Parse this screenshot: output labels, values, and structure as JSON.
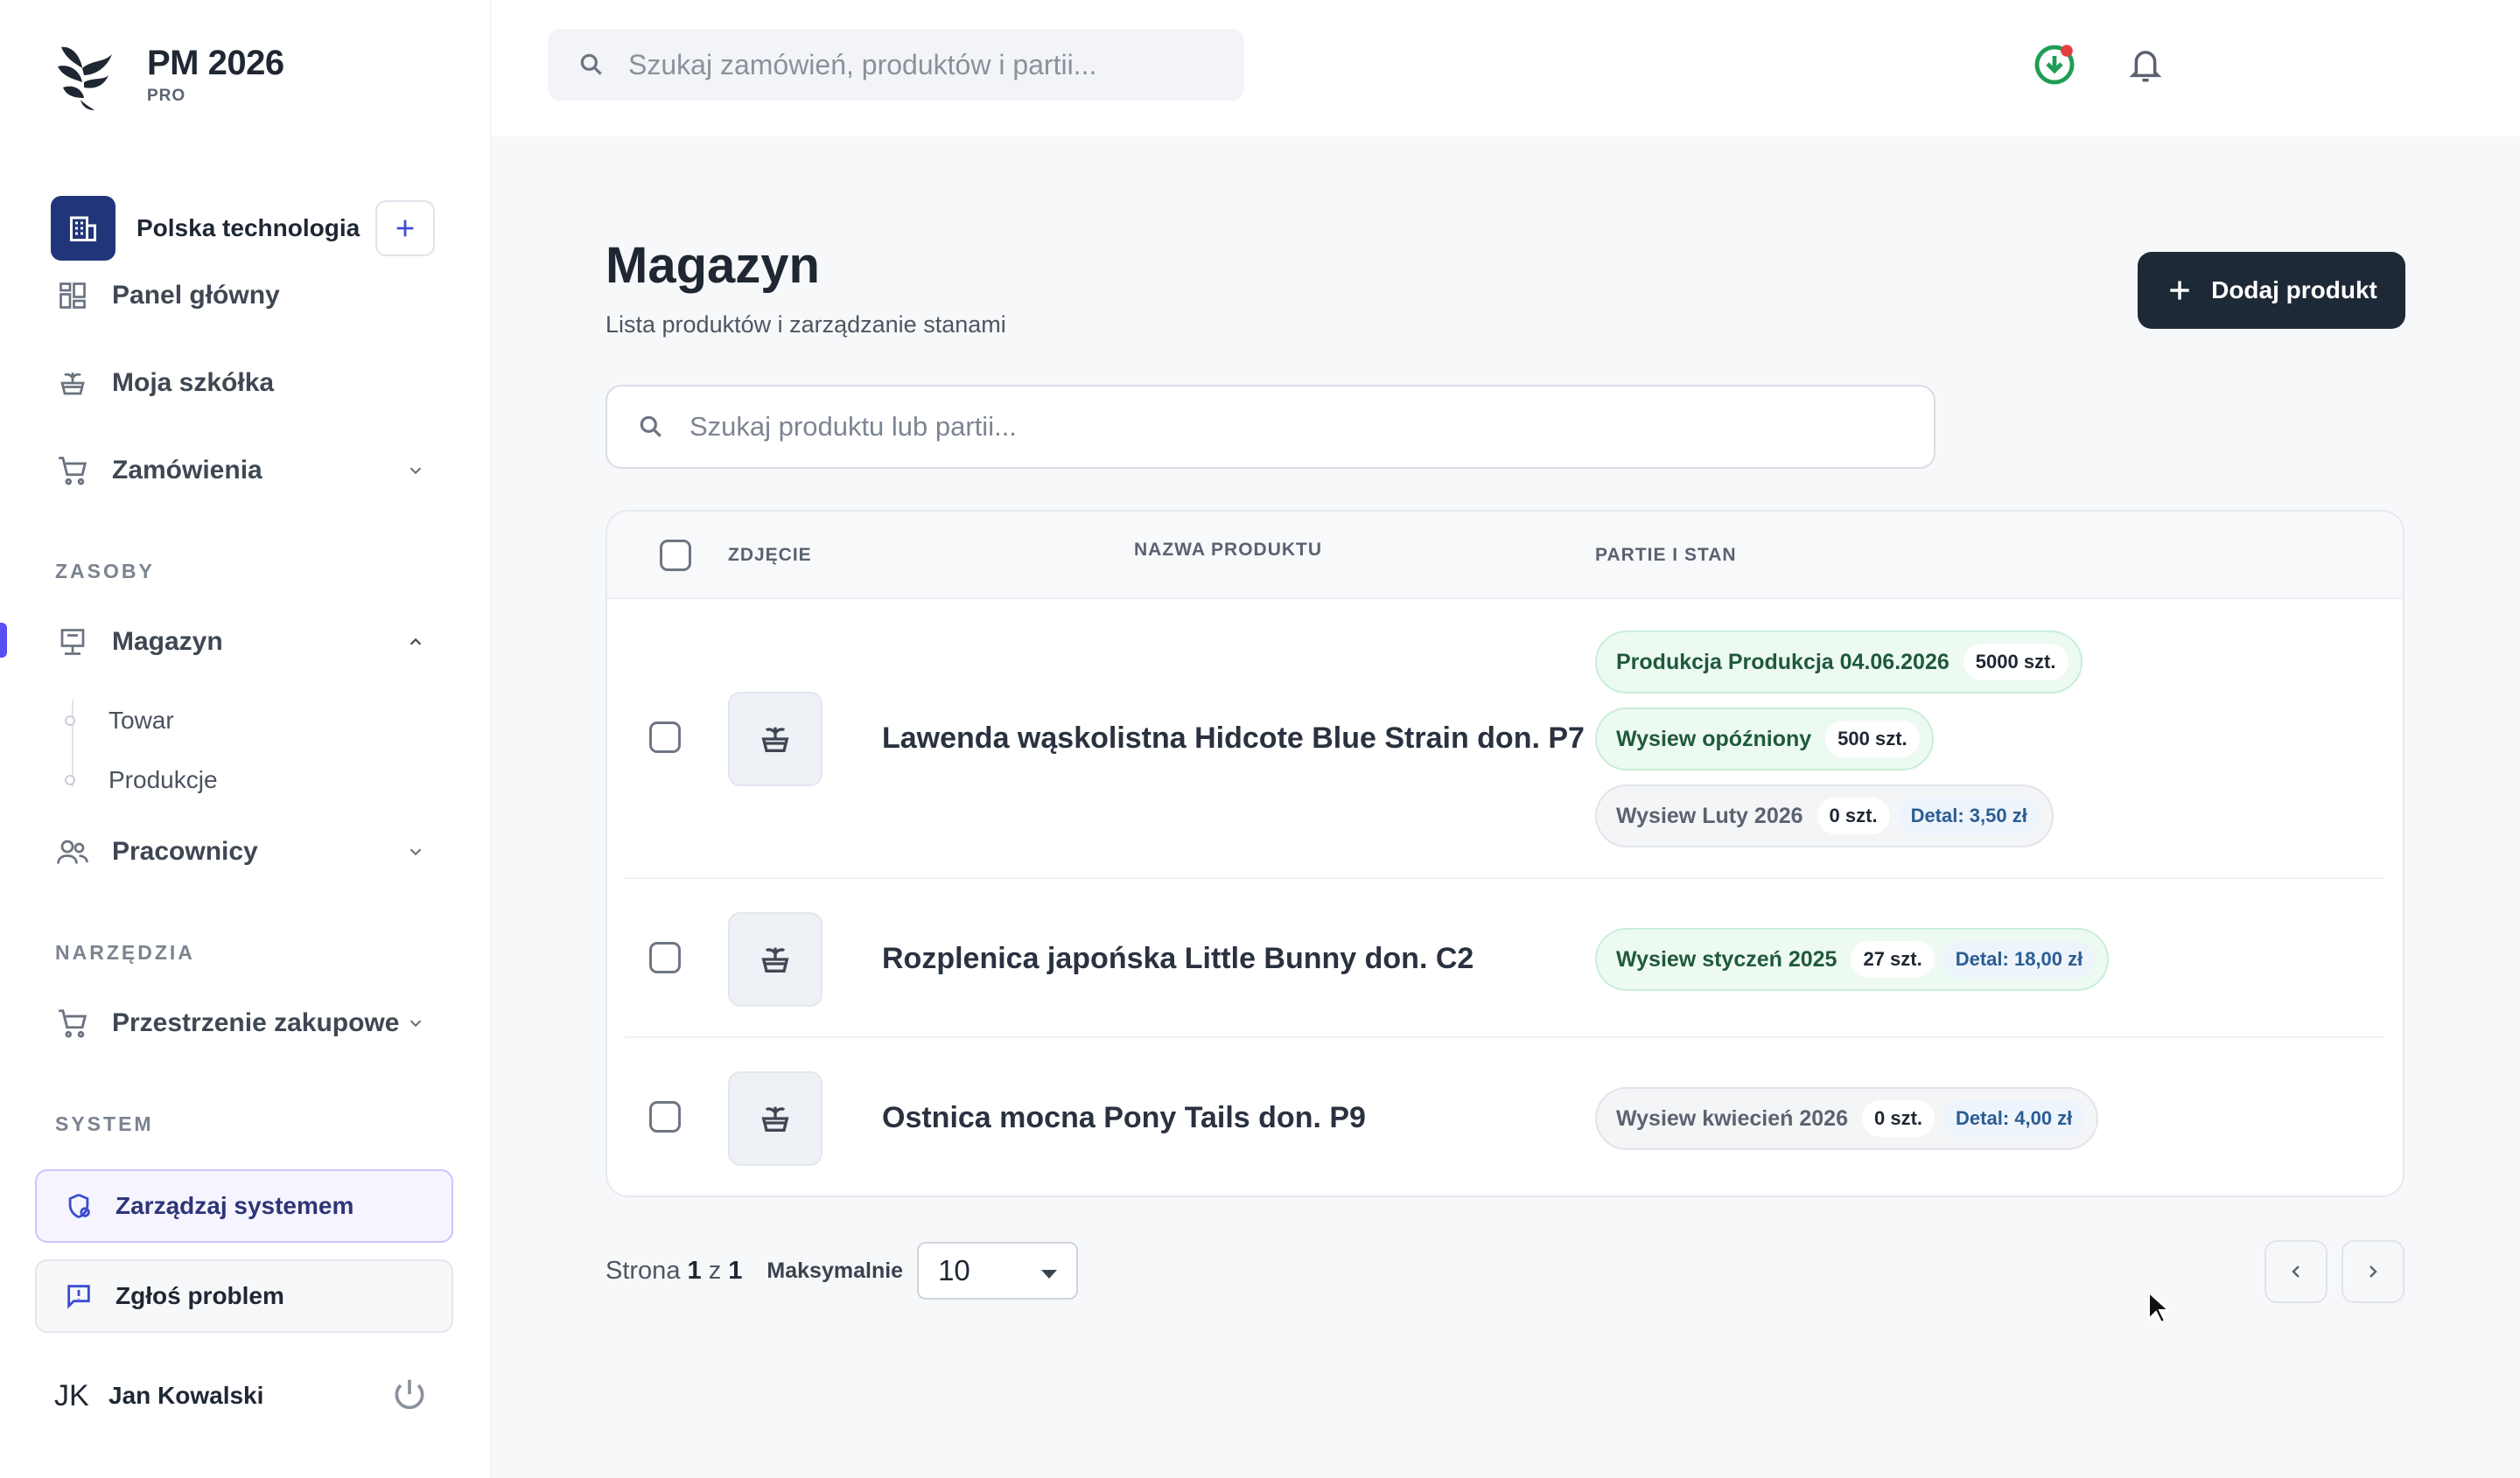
{
  "brand": {
    "name": "PM 2026",
    "tier": "PRO"
  },
  "organization": {
    "name": "Polska technologia"
  },
  "sidebar": {
    "items": [
      {
        "label": "Panel główny",
        "icon": "dashboard-icon"
      },
      {
        "label": "Moja szkółka",
        "icon": "plant-pot-icon"
      },
      {
        "label": "Zamówienia",
        "icon": "cart-icon",
        "expandable": true
      }
    ],
    "sections": {
      "resources": "ZASOBY",
      "tools": "NARZĘDZIA",
      "system": "SYSTEM"
    },
    "warehouse": {
      "label": "Magazyn",
      "icon": "warehouse-icon",
      "active": true,
      "children": [
        {
          "label": "Towar"
        },
        {
          "label": "Produkcje"
        }
      ]
    },
    "employees": {
      "label": "Pracownicy",
      "icon": "users-icon"
    },
    "purchasing": {
      "label": "Przestrzenie zakupowe",
      "icon": "cart-icon"
    },
    "manage_system": "Zarządzaj systemem",
    "report_problem": "Zgłoś problem",
    "user": {
      "initials": "JK",
      "name": "Jan Kowalski"
    }
  },
  "topbar": {
    "search_placeholder": "Szukaj zamówień, produktów i partii...",
    "status_color": "#1f9d55",
    "notification_dot_color": "#e53e3e"
  },
  "main": {
    "title": "Magazyn",
    "subtitle": "Lista produktów i zarządzanie stanami",
    "add_button": "Dodaj produkt",
    "search_placeholder": "Szukaj produktu lub partii...",
    "columns": {
      "photo": "ZDJĘCIE",
      "name": "NAZWA PRODUKTU",
      "batches": "PARTIE I STAN"
    },
    "products": [
      {
        "name": "Lawenda wąskolistna Hidcote Blue Strain don. P7",
        "batches": [
          {
            "label": "Produkcja Produkcja 04.06.2026",
            "qty": "5000 szt.",
            "price": "",
            "status": "green"
          },
          {
            "label": "Wysiew opóźniony",
            "qty": "500 szt.",
            "price": "",
            "status": "green"
          },
          {
            "label": "Wysiew Luty 2026",
            "qty": "0 szt.",
            "price": "Detal: 3,50 zł",
            "status": "gray"
          }
        ]
      },
      {
        "name": "Rozplenica japońska Little Bunny don. C2",
        "batches": [
          {
            "label": "Wysiew styczeń 2025",
            "qty": "27 szt.",
            "price": "Detal: 18,00 zł",
            "status": "green"
          }
        ]
      },
      {
        "name": "Ostnica mocna Pony Tails don. P9",
        "batches": [
          {
            "label": "Wysiew kwiecień 2026",
            "qty": "0 szt.",
            "price": "Detal: 4,00 zł",
            "status": "gray"
          }
        ]
      }
    ],
    "pagination": {
      "prefix": "Strona",
      "current": "1",
      "of": "z",
      "total": "1",
      "max_label": "Maksymalnie",
      "page_size": "10"
    }
  },
  "colors": {
    "accent": "#5a4ff2",
    "primary_dark": "#1e2937",
    "org_brand": "#21357a"
  }
}
